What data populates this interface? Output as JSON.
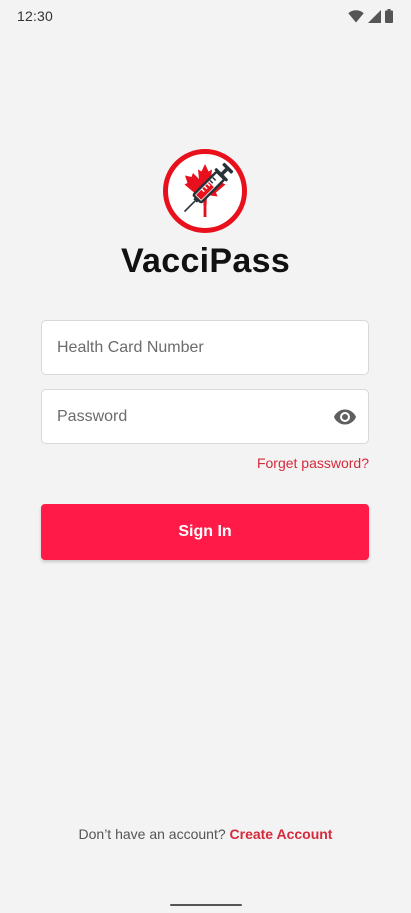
{
  "status_bar": {
    "time": "12:30",
    "icons": [
      "wifi-icon",
      "signal-icon",
      "battery-icon"
    ]
  },
  "app": {
    "title": "VacciPass",
    "logo": "maple-leaf-syringe-logo"
  },
  "form": {
    "health_card": {
      "placeholder": "Health Card Number",
      "value": ""
    },
    "password": {
      "placeholder": "Password",
      "value": "",
      "toggle_icon": "eye-icon"
    },
    "forgot_label": "Forget password?",
    "signin_label": "Sign In"
  },
  "footer": {
    "prompt": "Don’t have an account?",
    "create_label": "Create Account"
  },
  "colors": {
    "accent": "#ff1a48",
    "link": "#d42a3c",
    "logo_red": "#e8101c",
    "background": "#f3f3f3"
  }
}
